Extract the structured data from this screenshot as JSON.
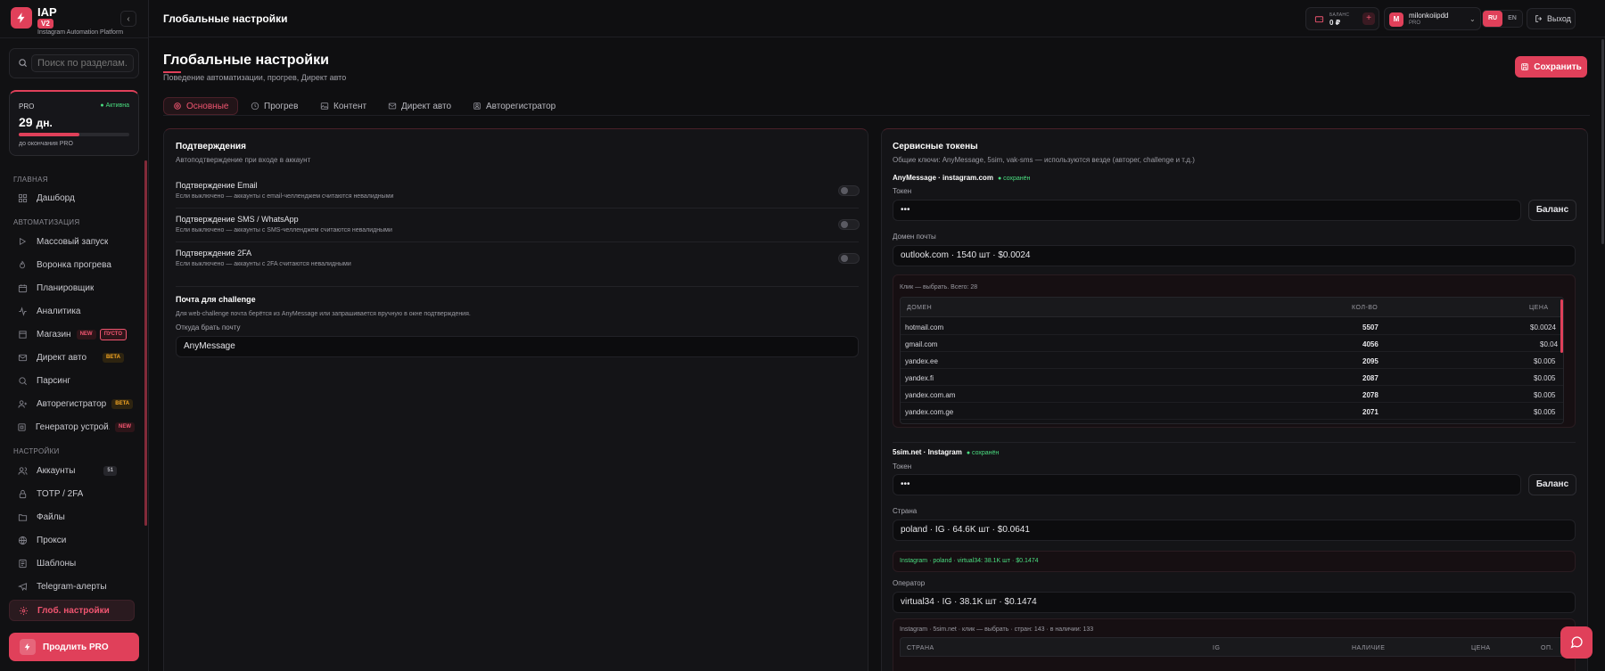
{
  "app": {
    "name": "IAP",
    "version": "V2",
    "subtitle": "Instagram Automation Platform"
  },
  "search": {
    "placeholder": "Поиск по разделам..."
  },
  "pro": {
    "label": "PRO",
    "status": "● Активна",
    "days": "29",
    "days_unit": "дн.",
    "note": "до окончания PRO",
    "progress": 0.55
  },
  "sidebar": {
    "section_main": "ГЛАВНАЯ",
    "section_automation": "АВТОМАТИЗАЦИЯ",
    "section_settings": "НАСТРОЙКИ",
    "items": [
      {
        "label": "Дашборд",
        "icon": "grid-icon"
      },
      {
        "label": "Массовый запуск",
        "icon": "play-icon"
      },
      {
        "label": "Воронка прогрева",
        "icon": "flame-icon"
      },
      {
        "label": "Планировщик",
        "icon": "calendar-icon"
      },
      {
        "label": "Аналитика",
        "icon": "activity-icon"
      },
      {
        "label": "Магазин",
        "icon": "store-icon",
        "badge1": "NEW",
        "badge2": "ПУСТО"
      },
      {
        "label": "Директ авто",
        "icon": "mail-icon",
        "badge1": "BETA"
      },
      {
        "label": "Парсинг",
        "icon": "search-icon"
      },
      {
        "label": "Авторегистратор",
        "icon": "user-plus-icon",
        "badge1": "BETA"
      },
      {
        "label": "Генератор устрой...",
        "icon": "device-icon",
        "badge1": "NEW"
      },
      {
        "label": "Аккаунты",
        "icon": "users-icon",
        "badge1": "51"
      },
      {
        "label": "TOTP / 2FA",
        "icon": "lock-icon"
      },
      {
        "label": "Файлы",
        "icon": "folder-icon"
      },
      {
        "label": "Прокси",
        "icon": "proxy-icon"
      },
      {
        "label": "Шаблоны",
        "icon": "template-icon"
      },
      {
        "label": "Telegram-алерты",
        "icon": "telegram-icon"
      },
      {
        "label": "Глоб. настройки",
        "icon": "gear-icon"
      }
    ],
    "extend_label": "Продлить PRO"
  },
  "topbar": {
    "title": "Глобальные настройки",
    "balance_label": "БАЛАНС",
    "balance_value": "0 ₽",
    "balance_add": "+",
    "user_initial": "M",
    "user_name": "milonkoiipdd",
    "user_role": "PRO",
    "lang_ru": "RU",
    "lang_en": "EN",
    "logout": "Выход"
  },
  "page": {
    "title": "Глобальные настройки",
    "subtitle": "Поведение автоматизации, прогрев, Директ авто",
    "save": "Сохранить",
    "tabs": [
      "Основные",
      "Прогрев",
      "Контент",
      "Директ авто",
      "Авторегистратор"
    ]
  },
  "confirmations": {
    "title": "Подтверждения",
    "subtitle": "Автоподтверждение при входе в аккаунт",
    "items": [
      {
        "title": "Подтверждение Email",
        "desc": "Если выключено — аккаунты с email-челленджем считаются невалидными",
        "on": false
      },
      {
        "title": "Подтверждение SMS / WhatsApp",
        "desc": "Если выключено — аккаунты с SMS-челленджем считаются невалидными",
        "on": false
      },
      {
        "title": "Подтверждение 2FA",
        "desc": "Если выключено — аккаунты с 2FA считаются невалидными",
        "on": false
      }
    ],
    "mail_title": "Почта для challenge",
    "mail_desc": "Для web-challenge почта берётся из AnyMessage или запрашивается вручную в окне подтверждения.",
    "mail_source_label": "Откуда брать почту",
    "mail_source_value": "AnyMessage"
  },
  "tokens": {
    "title": "Сервисные токены",
    "subtitle": "Общие ключи: AnyMessage, 5sim, vak-sms — используются везде (авторег, challenge и т.д.)",
    "anymessage": {
      "title": "AnyMessage · instagram.com",
      "saved": "● сохранён",
      "token_label": "Токен",
      "token_value": "•••",
      "balance_btn": "Баланс",
      "domain_label": "Домен почты",
      "domain_value": "outlook.com · 1540 шт · $0.0024",
      "hint": "Клик — выбрать. Всего: 28",
      "headers": [
        "ДОМЕН",
        "КОЛ-ВО",
        "ЦЕНА"
      ],
      "rows": [
        [
          "hotmail.com",
          "5507",
          "$0.0024"
        ],
        [
          "gmail.com",
          "4056",
          "$0.04"
        ],
        [
          "yandex.ee",
          "2095",
          "$0.005"
        ],
        [
          "yandex.fi",
          "2087",
          "$0.005"
        ],
        [
          "yandex.com.am",
          "2078",
          "$0.005"
        ],
        [
          "yandex.com.ge",
          "2071",
          "$0.005"
        ]
      ]
    },
    "fivesim": {
      "title": "5sim.net · Instagram",
      "saved": "● сохранён",
      "token_label": "Токен",
      "token_value": "•••",
      "balance_btn": "Баланс",
      "country_label": "Страна",
      "country_value": "poland · IG · 64.6K шт · $0.0641",
      "ig_note": "Instagram · poland · virtual34: 38.1K шт · $0.1474",
      "operator_label": "Оператор",
      "operator_value": "virtual34 · IG · 38.1K шт · $0.1474",
      "list_hint": "Instagram · 5sim.net · клик — выбрать · стран: 143 · в наличии: 133",
      "headers": [
        "СТРАНА",
        "IG",
        "НАЛИЧИЕ",
        "ЦЕНА",
        "ОП."
      ]
    }
  },
  "colors": {
    "accent": "#e0405a",
    "success": "#4ade80",
    "warning": "#f5a623",
    "bg": "#0f0f11"
  }
}
